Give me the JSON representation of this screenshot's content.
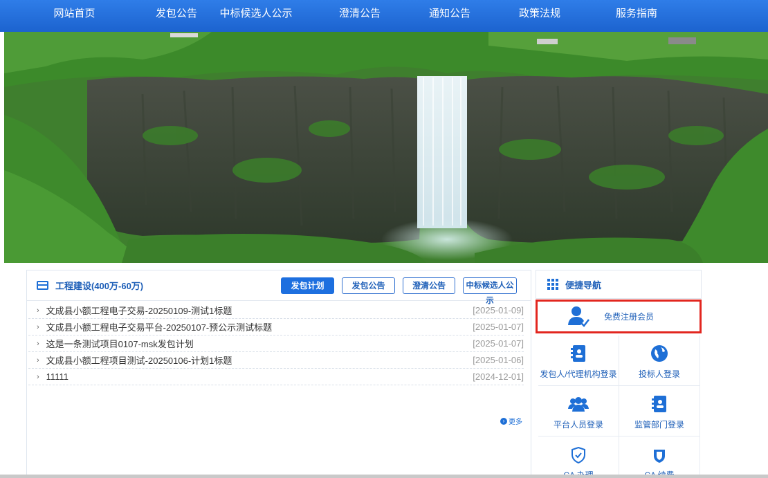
{
  "nav": {
    "items": [
      "网站首页",
      "发包公告",
      "中标候选人公示",
      "澄清公告",
      "通知公告",
      "政策法规",
      "服务指南"
    ]
  },
  "section": {
    "title": "工程建设(400万-60万)",
    "tabs": [
      {
        "label": "发包计划",
        "active": true
      },
      {
        "label": "发包公告",
        "active": false
      },
      {
        "label": "澄清公告",
        "active": false
      },
      {
        "label": "中标候选人公示",
        "active": false
      }
    ],
    "rows": [
      {
        "title": "文成县小额工程电子交易-20250109-测试1标题",
        "date": "[2025-01-09]"
      },
      {
        "title": "文成县小额工程电子交易平台-20250107-预公示测试标题",
        "date": "[2025-01-07]"
      },
      {
        "title": "这是一条测试项目0107-msk发包计划",
        "date": "[2025-01-07]"
      },
      {
        "title": "文成县小额工程项目测试-20250106-计划1标题",
        "date": "[2025-01-06]"
      },
      {
        "title": "11111",
        "date": "[2024-12-01]"
      }
    ],
    "more_label": "更多"
  },
  "quick_nav": {
    "title": "便捷导航",
    "register_label": "免费注册会员",
    "cells": [
      {
        "label": "发包人/代理机构登录",
        "icon": "id-card-icon"
      },
      {
        "label": "投标人登录",
        "icon": "globe-icon"
      },
      {
        "label": "平台人员登录",
        "icon": "users-icon"
      },
      {
        "label": "监管部门登录",
        "icon": "id-card-icon"
      },
      {
        "label": "CA 办理",
        "icon": "shield-check-icon"
      },
      {
        "label": "CA 续费",
        "icon": "shield-icon"
      }
    ]
  },
  "colors": {
    "nav_bg": "#1c63cf",
    "accent": "#1e6fd6",
    "highlight_border": "#e2261f"
  }
}
